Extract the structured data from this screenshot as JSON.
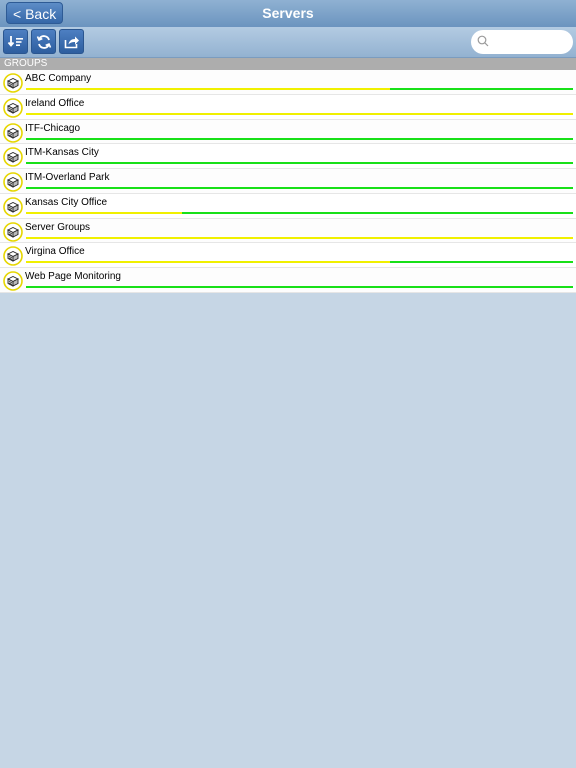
{
  "nav": {
    "back_label": "< Back",
    "title": "Servers"
  },
  "search": {
    "placeholder": "",
    "value": ""
  },
  "section": {
    "header": "GROUPS"
  },
  "colors": {
    "warning": "#f0f000",
    "ok": "#18e018"
  },
  "groups": [
    {
      "name": "ABC Company",
      "yellow_fraction": 0.665
    },
    {
      "name": "Ireland Office",
      "yellow_fraction": 1.0
    },
    {
      "name": "ITF-Chicago",
      "yellow_fraction": 0.0
    },
    {
      "name": "ITM-Kansas City",
      "yellow_fraction": 0.0
    },
    {
      "name": "ITM-Overland Park",
      "yellow_fraction": 0.0
    },
    {
      "name": "Kansas City Office",
      "yellow_fraction": 0.285
    },
    {
      "name": "Server Groups",
      "yellow_fraction": 1.0
    },
    {
      "name": "Virgina Office",
      "yellow_fraction": 0.665
    },
    {
      "name": "Web Page Monitoring",
      "yellow_fraction": 0.0
    }
  ]
}
